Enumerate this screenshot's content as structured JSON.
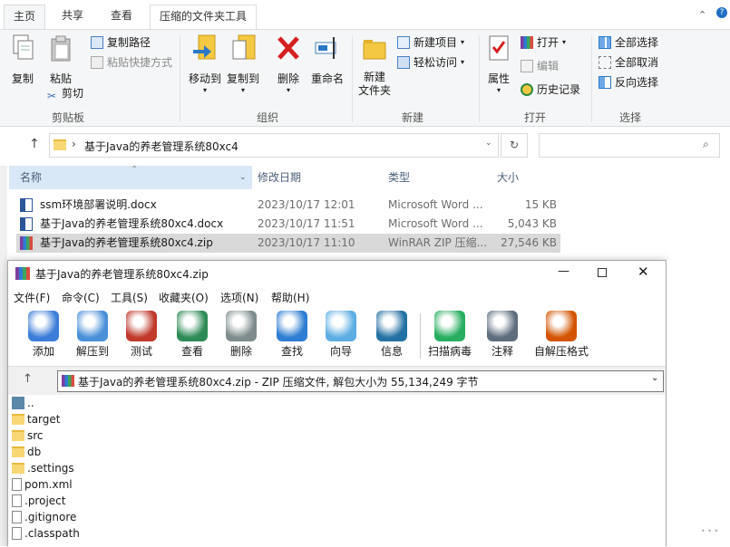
{
  "explorer": {
    "tabs": [
      {
        "label": "主页"
      },
      {
        "label": "共享"
      },
      {
        "label": "查看"
      },
      {
        "label": "压缩的文件夹工具"
      }
    ],
    "ribbon": {
      "clipboard": {
        "group_label": "剪贴板",
        "copy": "复制",
        "paste": "粘贴",
        "copy_path": "复制路径",
        "paste_shortcut": "粘贴快捷方式",
        "cut": "剪切"
      },
      "organize": {
        "group_label": "组织",
        "move_to": "移动到",
        "copy_to": "复制到",
        "delete": "删除",
        "rename": "重命名"
      },
      "new": {
        "group_label": "新建",
        "new_folder": "新建\n文件夹",
        "new_item": "新建项目",
        "easy_access": "轻松访问"
      },
      "open": {
        "group_label": "打开",
        "properties": "属性",
        "open": "打开",
        "edit": "编辑",
        "history": "历史记录"
      },
      "select": {
        "group_label": "选择",
        "select_all": "全部选择",
        "select_none": "全部取消",
        "invert": "反向选择"
      }
    },
    "address": {
      "path": "基于Java的养老管理系统80xc4"
    },
    "columns": {
      "name": "名称",
      "modified": "修改日期",
      "type": "类型",
      "size": "大小"
    },
    "files": [
      {
        "name": "ssm环境部署说明.docx",
        "modified": "2023/10/17 12:01",
        "type": "Microsoft Word ...",
        "size": "15 KB",
        "kind": "word"
      },
      {
        "name": "基于Java的养老管理系统80xc4.docx",
        "modified": "2023/10/17 11:51",
        "type": "Microsoft Word ...",
        "size": "5,043 KB",
        "kind": "word"
      },
      {
        "name": "基于Java的养老管理系统80xc4.zip",
        "modified": "2023/10/17 11:10",
        "type": "WinRAR ZIP 压缩...",
        "size": "27,546 KB",
        "kind": "rar",
        "selected": true
      }
    ]
  },
  "winrar": {
    "title": "基于Java的养老管理系统80xc4.zip",
    "menu": [
      "文件(F)",
      "命令(C)",
      "工具(S)",
      "收藏夹(O)",
      "选项(N)",
      "帮助(H)"
    ],
    "toolbar": [
      "添加",
      "解压到",
      "测试",
      "查看",
      "删除",
      "查找",
      "向导",
      "信息",
      "扫描病毒",
      "注释",
      "自解压格式"
    ],
    "path_text": "基于Java的养老管理系统80xc4.zip - ZIP 压缩文件, 解包大小为 55,134,249 字节",
    "items": [
      {
        "name": "..",
        "kind": "up"
      },
      {
        "name": "target",
        "kind": "folder"
      },
      {
        "name": "src",
        "kind": "folder"
      },
      {
        "name": "db",
        "kind": "folder"
      },
      {
        "name": ".settings",
        "kind": "folder"
      },
      {
        "name": "pom.xml",
        "kind": "xml"
      },
      {
        "name": ".project",
        "kind": "file"
      },
      {
        "name": ".gitignore",
        "kind": "file"
      },
      {
        "name": ".classpath",
        "kind": "file"
      }
    ]
  },
  "colors": {
    "ribbon_bg": "#f5f6f7",
    "selected_row": "#d9d9d9",
    "header_text": "#4c607a",
    "folder": "#f8d775"
  }
}
